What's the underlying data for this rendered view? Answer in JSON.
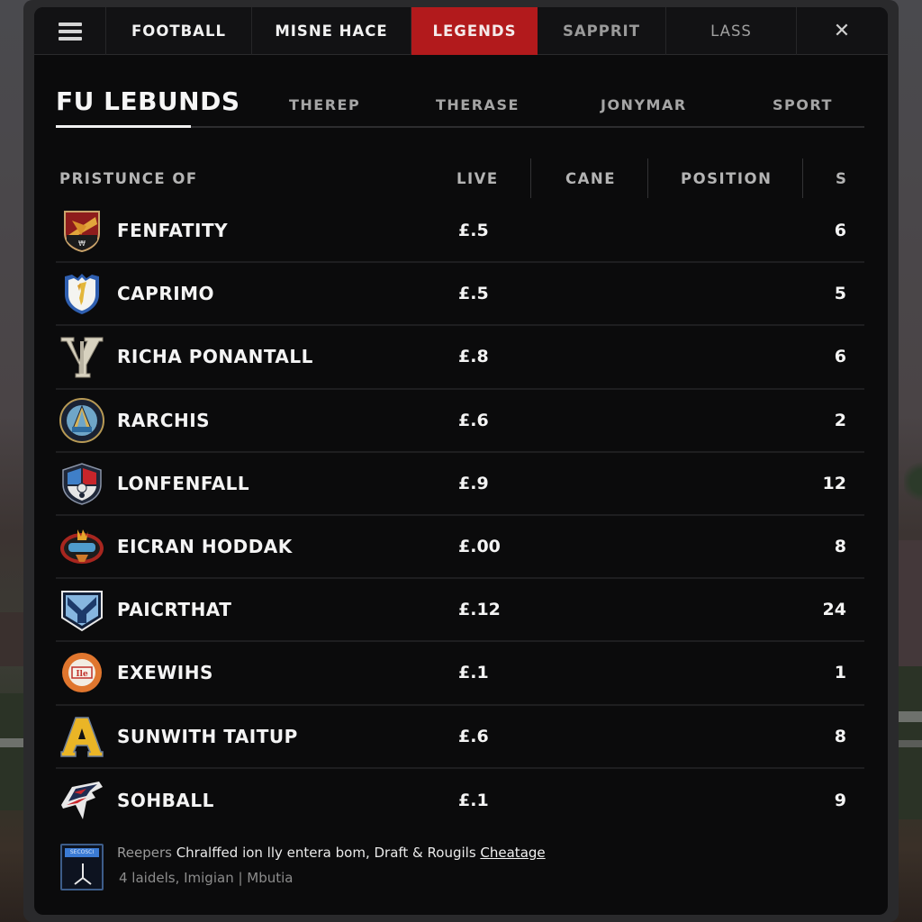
{
  "topnav": {
    "menu_icon": "hamburger-menu-icon",
    "tabs": [
      {
        "label": "FOOTBALL",
        "active": false
      },
      {
        "label": "MISNE HACE",
        "active": false
      },
      {
        "label": "LEGENDS",
        "active": true
      },
      {
        "label": "SAPPRIT",
        "active": false
      },
      {
        "label": "LASS",
        "active": false
      }
    ],
    "close_icon": "close-icon",
    "close_glyph": "✕",
    "active_color": "#b21a1c"
  },
  "subtabs": {
    "title": "FU LEBUNDS",
    "items": [
      "THEREP",
      "THERASE",
      "JONYMAR",
      "SPORT"
    ]
  },
  "table": {
    "headers": [
      "PRISTUNCE OF",
      "LIVE",
      "CANE",
      "POSITION",
      "S"
    ],
    "rows": [
      {
        "name": "FENFATITY",
        "live": "£.5",
        "s": "6",
        "logo": "red-gold-crest-icon"
      },
      {
        "name": "CAPRIMO",
        "live": "£.5",
        "s": "5",
        "logo": "blue-white-shield-icon"
      },
      {
        "name": "RICHA PONANTALL",
        "live": "£.8",
        "s": "6",
        "logo": "vy-monogram-icon"
      },
      {
        "name": "RARCHIS",
        "live": "£.6",
        "s": "2",
        "logo": "round-navy-seal-icon"
      },
      {
        "name": "LONFENFALL",
        "live": "£.9",
        "s": "12",
        "logo": "red-blue-shield-icon"
      },
      {
        "name": "EICRAN HODDAK",
        "live": "£.00",
        "s": "8",
        "logo": "red-goggles-emblem-icon"
      },
      {
        "name": "PAICRTHAT",
        "live": "£.12",
        "s": "24",
        "logo": "blue-y-shield-icon"
      },
      {
        "name": "EXEWIHS",
        "live": "£.1",
        "s": "1",
        "logo": "orange-round-badge-icon"
      },
      {
        "name": "SUNWITH TAITUP",
        "live": "£.6",
        "s": "8",
        "logo": "gold-letter-a-icon"
      },
      {
        "name": "SOHBALL",
        "live": "£.1",
        "s": "9",
        "logo": "hawk-head-icon"
      }
    ]
  },
  "footer": {
    "badge_tag": "SECOSCI",
    "badge_icon": "fork-symbol-icon",
    "line1_muted": "Reepers",
    "line1_text": " Chralffed ion lly entera bom, Draft & Rougils ",
    "line1_link": "Cheatage",
    "line2": "4 laidels, Imigian | Mbutia"
  }
}
